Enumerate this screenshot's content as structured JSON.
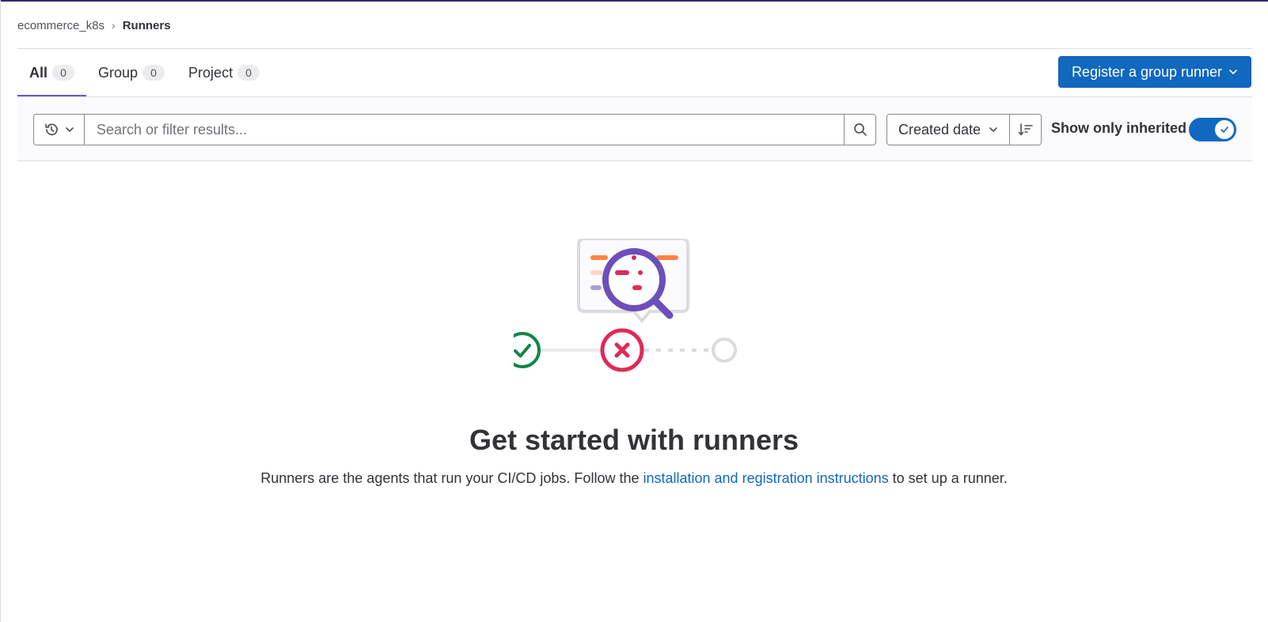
{
  "breadcrumb": {
    "group": "ecommerce_k8s",
    "current": "Runners"
  },
  "tabs": [
    {
      "label": "All",
      "count": "0",
      "active": true
    },
    {
      "label": "Group",
      "count": "0",
      "active": false
    },
    {
      "label": "Project",
      "count": "0",
      "active": false
    }
  ],
  "register_button": {
    "label": "Register a group runner",
    "icon": "chevron-down-icon"
  },
  "filter": {
    "history_icon": "history-icon",
    "search_placeholder": "Search or filter results...",
    "search_icon": "search-icon",
    "sort_label": "Created date",
    "sort_direction_icon": "sort-lowest-icon",
    "toggle_label": "Show only inherited",
    "toggle_on": true
  },
  "empty_state": {
    "title": "Get started with runners",
    "description_before": "Runners are the agents that run your CI/CD jobs. Follow the ",
    "link_text": "installation and registration instructions",
    "description_after": " to set up a runner."
  },
  "colors": {
    "primary": "#1068bf",
    "tab_active_underline": "#6b56cf",
    "success": "#108548",
    "danger": "#dd2b58",
    "illustration_purple": "#6b4fbb"
  }
}
